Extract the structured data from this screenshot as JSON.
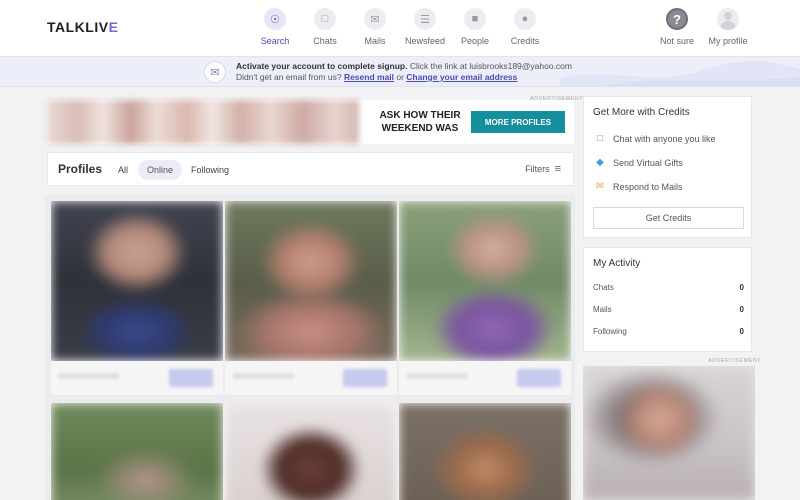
{
  "header": {
    "logo_main": "TALKLIV",
    "logo_accent": "E",
    "nav": [
      {
        "label": "Search",
        "icon": "search-icon",
        "active": true
      },
      {
        "label": "Chats",
        "icon": "chat-icon"
      },
      {
        "label": "Mails",
        "icon": "mail-icon"
      },
      {
        "label": "Newsfeed",
        "icon": "newsfeed-icon"
      },
      {
        "label": "People",
        "icon": "people-icon"
      },
      {
        "label": "Credits",
        "icon": "credits-icon"
      }
    ],
    "right": [
      {
        "label": "Not sure",
        "icon": "question-icon",
        "glyph": "?"
      },
      {
        "label": "My profile",
        "icon": "avatar-icon"
      }
    ]
  },
  "banner": {
    "bold_text": "Activate your account to complete signup.",
    "text1": " Click the link at luisbrooks189@yahoo.com",
    "text2": "Didn't get an email from us? ",
    "resend_link": "Resend mail",
    "or_text": " or ",
    "change_link": "Change your email address"
  },
  "ad": {
    "label": "ADVERTISEMENT",
    "line1": "ASK HOW THEIR",
    "line2": "WEEKEND WAS",
    "button": "MORE PROFILES"
  },
  "profiles": {
    "title": "Profiles",
    "tabs": [
      "All",
      "Online",
      "Following"
    ],
    "active_tab": "Online",
    "filters": "Filters"
  },
  "credits_panel": {
    "title": "Get More with Credits",
    "items": [
      {
        "label": "Chat with anyone you like",
        "icon": "chat-bubble-icon"
      },
      {
        "label": "Send Virtual Gifts",
        "icon": "diamond-icon"
      },
      {
        "label": "Respond to Mails",
        "icon": "envelope-icon"
      }
    ],
    "button": "Get Credits"
  },
  "activity": {
    "title": "My Activity",
    "rows": [
      {
        "label": "Chats",
        "value": "0"
      },
      {
        "label": "Mails",
        "value": "0"
      },
      {
        "label": "Following",
        "value": "0"
      }
    ]
  },
  "side_ad": {
    "label": "ADVERTISEMENT"
  }
}
